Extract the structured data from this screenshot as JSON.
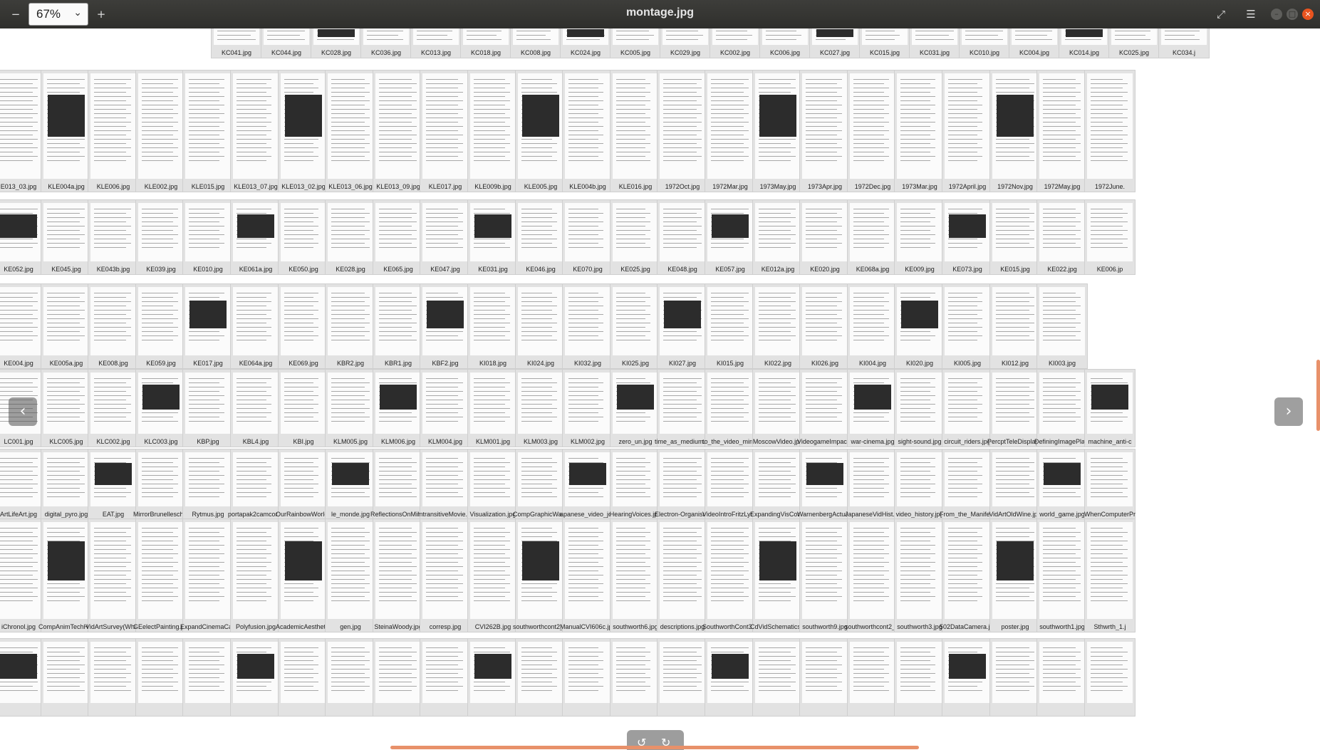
{
  "toolbar": {
    "zoom_out_icon": "minus-icon",
    "zoom_value": "67%",
    "zoom_in_icon": "plus-icon",
    "title": "montage.jpg",
    "fullscreen_icon": "fullscreen-icon",
    "menu_icon": "hamburger-menu-icon"
  },
  "window_controls": [
    "minimize",
    "maximize",
    "close"
  ],
  "colors": {
    "titlebar": "#3d3d3a",
    "close": "#e9541f",
    "accent": "#e8916a"
  },
  "thumbnails": [
    [
      "KC041.jpg",
      "KC044.jpg",
      "KC028.jpg",
      "KC036.jpg",
      "KC013.jpg",
      "KC018.jpg",
      "KC008.jpg",
      "KC024.jpg",
      "KC005.jpg",
      "KC029.jpg",
      "KC002.jpg",
      "KC006.jpg",
      "KC027.jpg",
      "KC015.jpg",
      "KC031.jpg",
      "KC010.jpg",
      "KC004.jpg",
      "KC014.jpg",
      "KC025.jpg",
      "KC034.j"
    ],
    [
      "E013_03.jpg",
      "KLE004a.jpg",
      "KLE006.jpg",
      "KLE002.jpg",
      "KLE015.jpg",
      "KLE013_07.jpg",
      "KLE013_02.jpg",
      "KLE013_06.jpg",
      "KLE013_09.jpg",
      "KLE017.jpg",
      "KLE009b.jpg",
      "KLE005.jpg",
      "KLE004b.jpg",
      "KLE016.jpg",
      "1972Oct.jpg",
      "1972Mar.jpg",
      "1973May.jpg",
      "1973Apr.jpg",
      "1972Dec.jpg",
      "1973Mar.jpg",
      "1972April.jpg",
      "1972Nov.jpg",
      "1972May.jpg",
      "1972June."
    ],
    [
      "KE052.jpg",
      "KE045.jpg",
      "KE043b.jpg",
      "KE039.jpg",
      "KE010.jpg",
      "KE061a.jpg",
      "KE050.jpg",
      "KE028.jpg",
      "KE065.jpg",
      "KE047.jpg",
      "KE031.jpg",
      "KE046.jpg",
      "KE070.jpg",
      "KE025.jpg",
      "KE048.jpg",
      "KE057.jpg",
      "KE012a.jpg",
      "KE020.jpg",
      "KE068a.jpg",
      "KE009.jpg",
      "KE073.jpg",
      "KE015.jpg",
      "KE022.jpg",
      "KE006.jp"
    ],
    [
      "KE004.jpg",
      "KE005a.jpg",
      "KE008.jpg",
      "KE059.jpg",
      "KE017.jpg",
      "KE064a.jpg",
      "KE069.jpg",
      "KBR2.jpg",
      "KBR1.jpg",
      "KBF2.jpg",
      "KI018.jpg",
      "KI024.jpg",
      "KI032.jpg",
      "KI025.jpg",
      "KI027.jpg",
      "KI015.jpg",
      "KI022.jpg",
      "KI026.jpg",
      "KI004.jpg",
      "KI020.jpg",
      "KI005.jpg",
      "KI012.jpg",
      "KI003.jpg"
    ],
    [
      "LC001.jpg",
      "KLC005.jpg",
      "KLC002.jpg",
      "KLC003.jpg",
      "KBP.jpg",
      "KBL4.jpg",
      "KBI.jpg",
      "KLM005.jpg",
      "KLM006.jpg",
      "KLM004.jpg",
      "KLM001.jpg",
      "KLM003.jpg",
      "KLM002.jpg",
      "zero_un.jpg",
      "time_as_medium.jpg",
      "to_the_video_mirror.jp",
      "MoscowVideo.jpg",
      "VideogameImpact.jpg",
      "war-cinema.jpg",
      "sight-sound.jpg",
      "circuit_riders.jpg",
      "PercptTeleDisplays.jp",
      "DefiningImagePlace.jp",
      "machine_anti-c"
    ],
    [
      "ArtLifeArt.jpg",
      "digital_pyro.jpg",
      "EAT.jpg",
      "MirrorBrunelleschi.jpg",
      "Rytmus.jpg",
      "portapak2camcorder.jp",
      "OurRainbowWorld.jpg",
      "le_monde.jpg",
      "ReflectionsOnMirrors.jp",
      "IntransitiveMovie.jpg",
      "Visualization.jpg",
      "CompGraphicWayLife.jp",
      "apanese_video_journal.j",
      "HearingVoices.jpg",
      "Electron-Organism.jpg",
      "VideoIntroFritzLyob.jp",
      "ExpandingVisCommRev.jp",
      "WarnenbergActualPossibl.j",
      "JapaneseVidHist.jpg",
      "video_history.jpg",
      "From_the_Manifesto.jp",
      "VidArtOldWine.jpg",
      "world_game.jpg",
      "WhenComputerPr"
    ],
    [
      "iChronol.jpg",
      "CompAnimTechHist.jpg",
      "VidArtSurvey(Whitney).jpg",
      "GEelectPainting.jpg",
      "ExpandCinemaCalendar.jpg",
      "Polyfusion.jpg",
      "AcademicAesthetic.jpg",
      "gen.jpg",
      "SteinaWoody.jpg",
      "corresp.jpg",
      "CVI262B.jpg",
      "southworthcont2_3-12.j",
      "ManualCVI606c.jpg",
      "southworth6.jpg",
      "descriptions.jpg",
      "SouthworthCont3.jpg",
      "CdVidSchematics.jpg",
      "southworth9.jpg",
      "southworthcont2_1.jpg",
      "southworth3.jpg",
      "502DataCamera.jpg",
      "poster.jpg",
      "southworth1.jpg",
      "Sthwrth_1.j"
    ],
    [
      "",
      "",
      "",
      "",
      "",
      "",
      "",
      "",
      "",
      "",
      "",
      "",
      "",
      "",
      "",
      "",
      "",
      "",
      "",
      "",
      "",
      "",
      "",
      ""
    ]
  ],
  "nav": {
    "prev_icon": "chevron-left-icon",
    "next_icon": "chevron-right-icon"
  },
  "bottom_tools": {
    "rotate_left_icon": "rotate-left-icon",
    "rotate_right_icon": "rotate-right-icon"
  }
}
